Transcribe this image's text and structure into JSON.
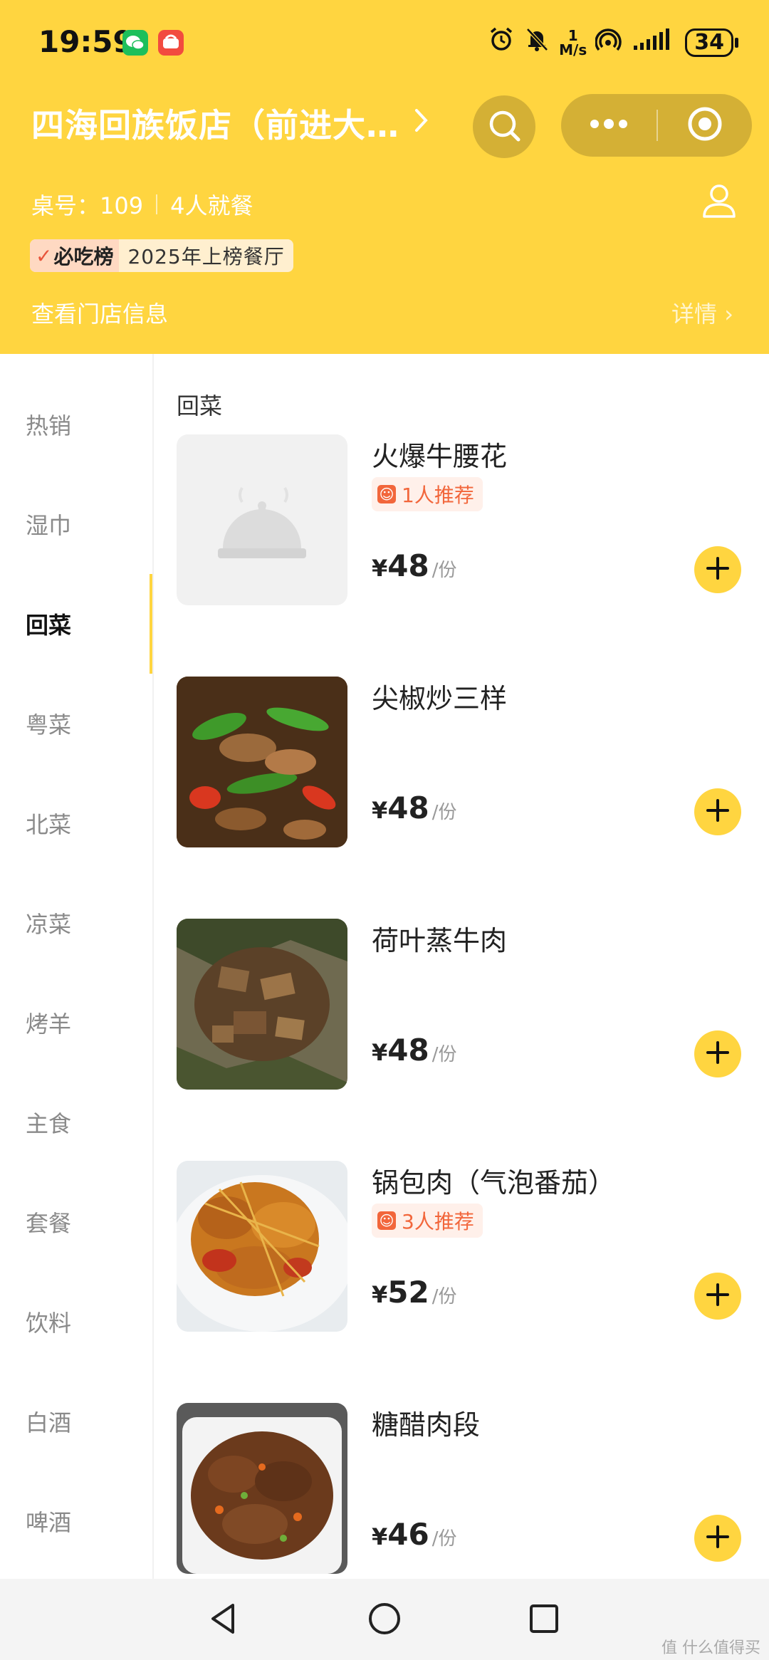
{
  "status_bar": {
    "time": "19:59",
    "net_speed_top": "1",
    "net_speed_unit": "M/s",
    "signal_sup": "1",
    "battery": "34"
  },
  "header": {
    "store_title": "四海回族饭店（前进大…",
    "table_label": "桌号：109",
    "diners": "4人就餐",
    "rank_label": "必吃榜",
    "rank_text": "2025年上榜餐厅",
    "store_info_link": "查看门店信息",
    "details_link": "详情 ›"
  },
  "sidebar": {
    "items": [
      {
        "label": "热销"
      },
      {
        "label": "湿巾"
      },
      {
        "label": "回菜"
      },
      {
        "label": "粤菜"
      },
      {
        "label": "北菜"
      },
      {
        "label": "凉菜"
      },
      {
        "label": "烤羊"
      },
      {
        "label": "主食"
      },
      {
        "label": "套餐"
      },
      {
        "label": "饮料"
      },
      {
        "label": "白酒"
      },
      {
        "label": "啤酒"
      }
    ],
    "active_index": 2
  },
  "menu": {
    "section_title": "回菜",
    "dishes": [
      {
        "name": "火爆牛腰花",
        "recommend": "1人推荐",
        "yen": "¥",
        "price": "48",
        "unit": "/份"
      },
      {
        "name": "尖椒炒三样",
        "recommend": "",
        "yen": "¥",
        "price": "48",
        "unit": "/份"
      },
      {
        "name": "荷叶蒸牛肉",
        "recommend": "",
        "yen": "¥",
        "price": "48",
        "unit": "/份"
      },
      {
        "name": "锅包肉（气泡番茄）",
        "recommend": "3人推荐",
        "yen": "¥",
        "price": "52",
        "unit": "/份"
      },
      {
        "name": "糖醋肉段",
        "recommend": "",
        "yen": "¥",
        "price": "46",
        "unit": "/份"
      }
    ]
  },
  "watermark": "值 什么值得买",
  "colors": {
    "accent": "#FFD540",
    "recommend": "#F2663B"
  }
}
